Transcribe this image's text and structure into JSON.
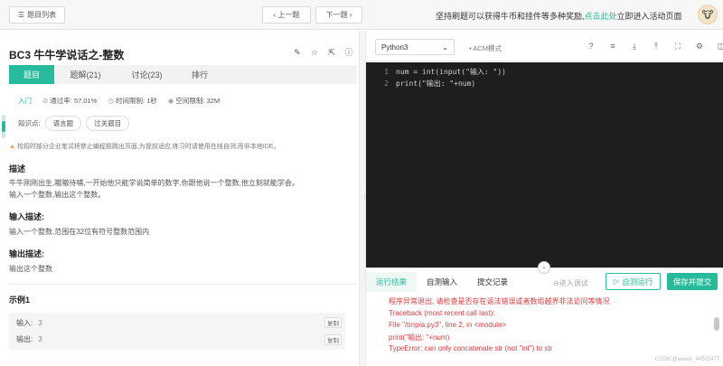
{
  "topbar": {
    "list_label": "题目列表",
    "prev_label": "上一题",
    "next_label": "下一题",
    "promo_text": "坚持刷题可以获得牛币和挂件等多种奖励,",
    "promo_link": "点击此处",
    "promo_tail": "立即进入活动页面"
  },
  "problem": {
    "title": "BC3  牛牛学说话之-整数",
    "tabs": [
      "题目",
      "题解(21)",
      "讨论(23)",
      "排行"
    ],
    "difficulty": "入门",
    "pass_rate": "通过率: 57.01%",
    "time_limit": "时间限制: 1秒",
    "space_limit": "空间限制: 32M",
    "knowledge_label": "知识点:",
    "knowledge_tags": [
      "语言题",
      "过关题目"
    ],
    "warning": "校招时部分企业笔试将禁止编程题跳出页面,为提前适应,练习时请使用在线自测,而非本地IDE。",
    "desc_heading": "描述",
    "desc_text": "牛牛刚刚出生,嗷嗷待哺,一开始他只能学说简单的数字,你跟他说一个整数,他立刻就能学会。",
    "desc_text2": "输入一个整数,输出这个整数。",
    "input_heading": "输入描述:",
    "input_text": "输入一个整数,范围在32位有符号整数范围内",
    "output_heading": "输出描述:",
    "output_text": "输出这个整数",
    "example_heading": "示例1",
    "example_input_label": "输入:",
    "example_input_value": "3",
    "example_output_label": "输出:",
    "example_output_value": "3",
    "copy_label": "复制"
  },
  "editor": {
    "language": "Python3",
    "acm_label": "ACM模式",
    "lines": [
      {
        "num": "1",
        "text": "num = int(input(\"输入: \"))"
      },
      {
        "num": "2",
        "text": "print(\"输出: \"+num)"
      }
    ]
  },
  "result": {
    "tabs": [
      "运行结果",
      "自测输入",
      "提交记录"
    ],
    "debug_label": "进入调试",
    "run_label": "自测运行",
    "submit_label": "保存并提交",
    "error_lines": [
      "程序异常退出, 请检查是否存在语法错误或者数组越界非法访问等情况",
      "Traceback (most recent call last):",
      "File \"/tmp/a.py3\", line 2, in <module>",
      "print(\"输出: \"+num)",
      "TypeError: can only concatenate str (not \"int\") to str"
    ],
    "watermark": "CSDN @weixin_44522477"
  },
  "colors": {
    "accent": "#25bb9b",
    "error": "#e4393c",
    "editor_bg": "#1e1e1e"
  }
}
